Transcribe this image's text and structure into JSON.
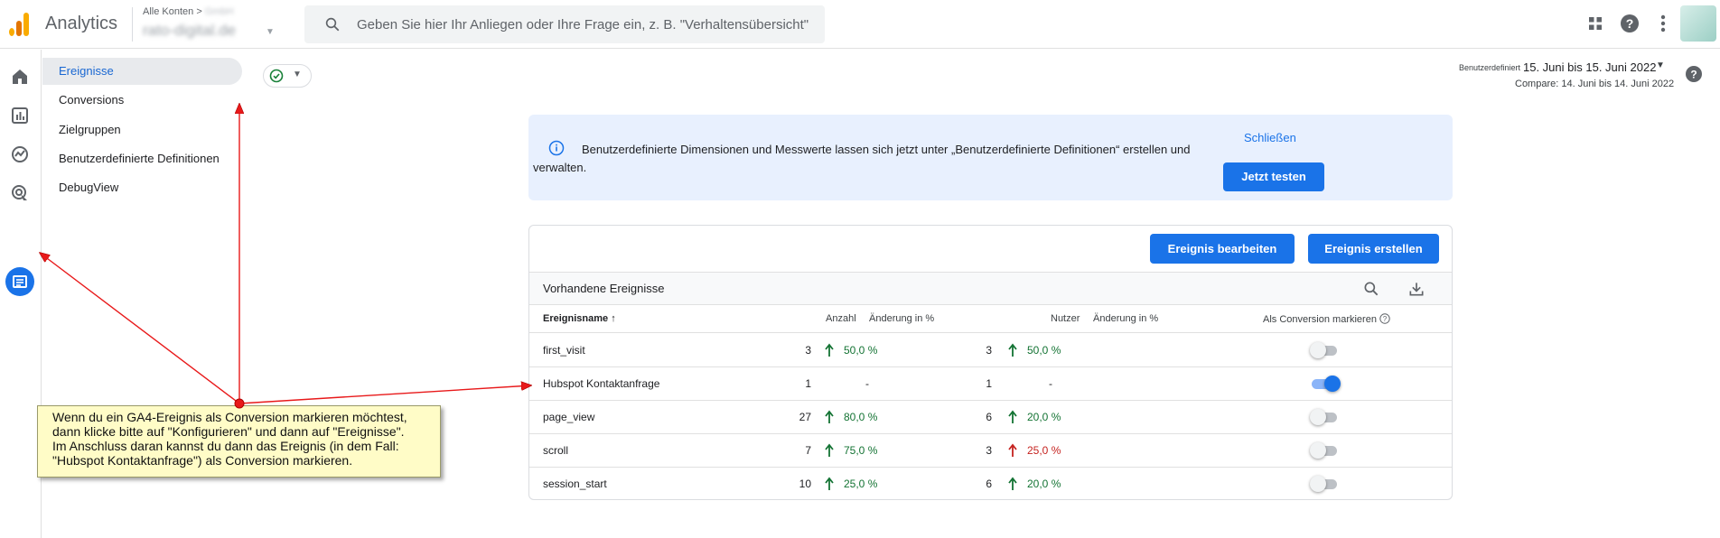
{
  "header": {
    "app_title": "Analytics",
    "account_breadcrumb": "Alle Konten >",
    "account_blurred": "GmbH",
    "property_name": "rato-digital.de",
    "search_placeholder": "Geben Sie hier Ihr Anliegen oder Ihre Frage ein, z. B. \"Verhaltensübersicht\"",
    "icons": [
      "apps-grid-icon",
      "help-icon",
      "more-vert-icon"
    ]
  },
  "rail": {
    "icons": [
      "home-icon",
      "reports-icon",
      "explore-icon",
      "advertising-icon",
      "configure-icon"
    ]
  },
  "nav": {
    "items": [
      {
        "label": "Ereignisse",
        "active": true
      },
      {
        "label": "Conversions",
        "active": false
      },
      {
        "label": "Zielgruppen",
        "active": false
      },
      {
        "label": "Benutzerdefinierte Definitionen",
        "active": false
      },
      {
        "label": "DebugView",
        "active": false
      }
    ]
  },
  "date_range": {
    "label": "Benutzerdefiniert",
    "range": "15. Juni bis 15. Juni 2022",
    "compare": "Compare: 14. Juni bis 14. Juni 2022"
  },
  "banner": {
    "text": "Benutzerdefinierte Dimensionen und Messwerte lassen sich jetzt unter „Benutzerdefinierte Definitionen“ erstellen und verwalten.",
    "close_label": "Schließen",
    "cta_label": "Jetzt testen"
  },
  "events": {
    "edit_button": "Ereignis bearbeiten",
    "create_button": "Ereignis erstellen",
    "section_title": "Vorhandene Ereignisse",
    "columns": {
      "name": "Ereignisname",
      "count": "Anzahl",
      "count_change": "Änderung in %",
      "users": "Nutzer",
      "users_change": "Änderung in %",
      "conversion": "Als Conversion markieren"
    },
    "rows": [
      {
        "name": "first_visit",
        "count": "3",
        "count_change": "50,0 %",
        "count_dir": "up",
        "users": "3",
        "users_change": "50,0 %",
        "users_dir": "up",
        "conversion": false
      },
      {
        "name": "Hubspot Kontaktanfrage",
        "count": "1",
        "count_change": "-",
        "count_dir": "none",
        "users": "1",
        "users_change": "-",
        "users_dir": "none",
        "conversion": true
      },
      {
        "name": "page_view",
        "count": "27",
        "count_change": "80,0 %",
        "count_dir": "up",
        "users": "6",
        "users_change": "20,0 %",
        "users_dir": "up",
        "conversion": false
      },
      {
        "name": "scroll",
        "count": "7",
        "count_change": "75,0 %",
        "count_dir": "up",
        "users": "3",
        "users_change": "25,0 %",
        "users_dir": "down",
        "conversion": false
      },
      {
        "name": "session_start",
        "count": "10",
        "count_change": "25,0 %",
        "count_dir": "up",
        "users": "6",
        "users_change": "20,0 %",
        "users_dir": "up",
        "conversion": false
      }
    ]
  },
  "annotation": {
    "lines": [
      "Wenn du ein GA4-Ereignis als Conversion markieren möchtest,",
      "dann klicke bitte auf \"Konfigurieren\" und dann auf \"Ereignisse\".",
      "Im Anschluss daran kannst du dann das Ereignis (in dem Fall:",
      "\"Hubspot Kontaktanfrage\") als Conversion markieren."
    ]
  },
  "colors": {
    "brand_orange": "#f9ab00",
    "primary_blue": "#1a73e8",
    "positive_green": "#137333",
    "negative_red": "#c5221f",
    "annotation_red": "#e8191a",
    "note_yellow": "#fffcc7"
  }
}
